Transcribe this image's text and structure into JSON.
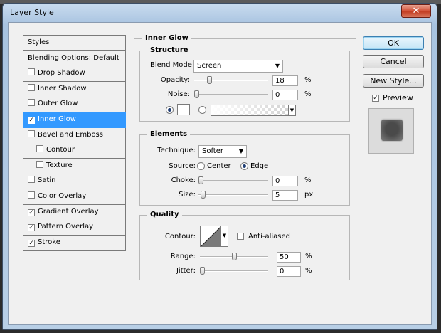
{
  "window": {
    "title": "Layer Style",
    "close_glyph": "✕"
  },
  "styles_list": {
    "items": [
      {
        "label": "Styles",
        "checkbox": false,
        "checked": false,
        "selected": false,
        "sub": false
      },
      {
        "label": "Blending Options: Default",
        "checkbox": false,
        "checked": false,
        "selected": false,
        "sub": false
      },
      {
        "label": "Drop Shadow",
        "checkbox": true,
        "checked": false,
        "selected": false,
        "sub": false
      },
      {
        "label": "Inner Shadow",
        "checkbox": true,
        "checked": false,
        "selected": false,
        "sub": false
      },
      {
        "label": "Outer Glow",
        "checkbox": true,
        "checked": false,
        "selected": false,
        "sub": false
      },
      {
        "label": "Inner Glow",
        "checkbox": true,
        "checked": true,
        "selected": true,
        "sub": false
      },
      {
        "label": "Bevel and Emboss",
        "checkbox": true,
        "checked": false,
        "selected": false,
        "sub": false
      },
      {
        "label": "Contour",
        "checkbox": true,
        "checked": false,
        "selected": false,
        "sub": true
      },
      {
        "label": "Texture",
        "checkbox": true,
        "checked": false,
        "selected": false,
        "sub": true
      },
      {
        "label": "Satin",
        "checkbox": true,
        "checked": false,
        "selected": false,
        "sub": false
      },
      {
        "label": "Color Overlay",
        "checkbox": true,
        "checked": false,
        "selected": false,
        "sub": false
      },
      {
        "label": "Gradient Overlay",
        "checkbox": true,
        "checked": true,
        "selected": false,
        "sub": false
      },
      {
        "label": "Pattern Overlay",
        "checkbox": true,
        "checked": true,
        "selected": false,
        "sub": false
      },
      {
        "label": "Stroke",
        "checkbox": true,
        "checked": true,
        "selected": false,
        "sub": false
      }
    ]
  },
  "inner_glow": {
    "title": "Inner Glow",
    "structure": {
      "title": "Structure",
      "blend_mode_label": "Blend Mode:",
      "blend_mode_value": "Screen",
      "opacity_label": "Opacity:",
      "opacity_value": "18",
      "opacity_fraction": 0.18,
      "opacity_unit": "%",
      "noise_label": "Noise:",
      "noise_value": "0",
      "noise_fraction": 0,
      "noise_unit": "%",
      "glow_mode": "color",
      "glow_color": "#ffffff"
    },
    "elements": {
      "title": "Elements",
      "technique_label": "Technique:",
      "technique_value": "Softer",
      "source_label": "Source:",
      "source_center": "Center",
      "source_edge": "Edge",
      "source_selected": "edge",
      "choke_label": "Choke:",
      "choke_value": "0",
      "choke_fraction": 0,
      "choke_unit": "%",
      "size_label": "Size:",
      "size_value": "5",
      "size_fraction": 0.03,
      "size_unit": "px"
    },
    "quality": {
      "title": "Quality",
      "contour_label": "Contour:",
      "antialiased_label": "Anti-aliased",
      "antialiased_checked": false,
      "range_label": "Range:",
      "range_value": "50",
      "range_fraction": 0.5,
      "range_unit": "%",
      "jitter_label": "Jitter:",
      "jitter_value": "0",
      "jitter_fraction": 0,
      "jitter_unit": "%"
    }
  },
  "buttons": {
    "ok": "OK",
    "cancel": "Cancel",
    "new_style": "New Style..."
  },
  "preview": {
    "label": "Preview",
    "checked": true
  },
  "colors": {
    "selection": "#3399ff",
    "close_button": "#c23a1f",
    "glow_color": "#ffffff"
  }
}
